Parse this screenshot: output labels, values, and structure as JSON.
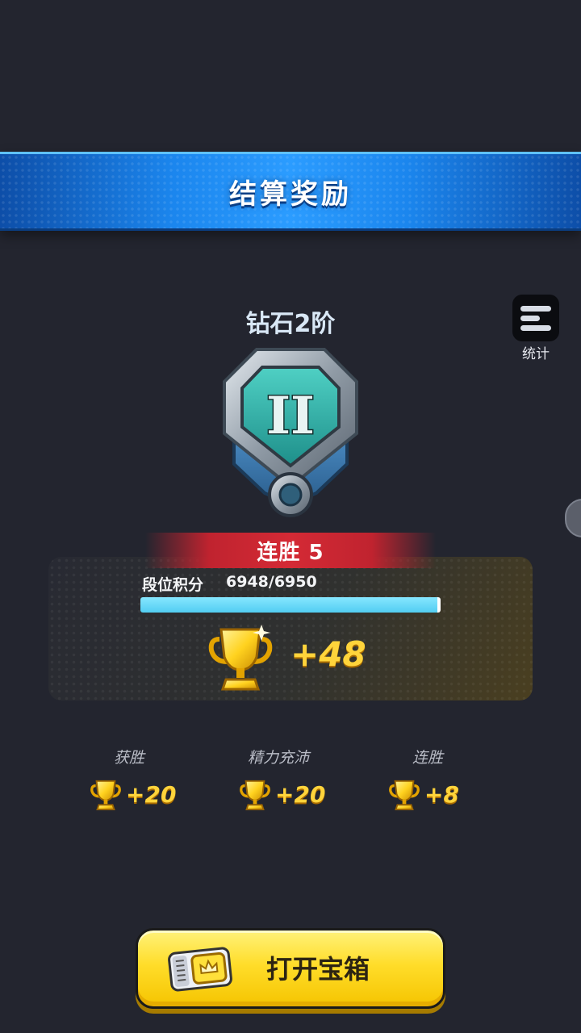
{
  "banner": {
    "title": "结算奖励"
  },
  "stats": {
    "label": "统计",
    "icon": "menu-lines-icon"
  },
  "rank": {
    "name": "钻石2阶",
    "tier_numeral": "II"
  },
  "streak": {
    "label": "连胜 5"
  },
  "points": {
    "label": "段位积分",
    "value": "6948/6950",
    "current": 6948,
    "max": 6950
  },
  "total_gain": "+48",
  "breakdown": [
    {
      "label": "获胜",
      "value": "+20"
    },
    {
      "label": "精力充沛",
      "value": "+20"
    },
    {
      "label": "连胜",
      "value": "+8"
    }
  ],
  "open_button": {
    "label": "打开宝箱"
  },
  "colors": {
    "background": "#23252f",
    "banner": "#1b86ee",
    "gold": "#ffd43b",
    "progress": "#52cdf2",
    "streak": "#c0232f"
  }
}
